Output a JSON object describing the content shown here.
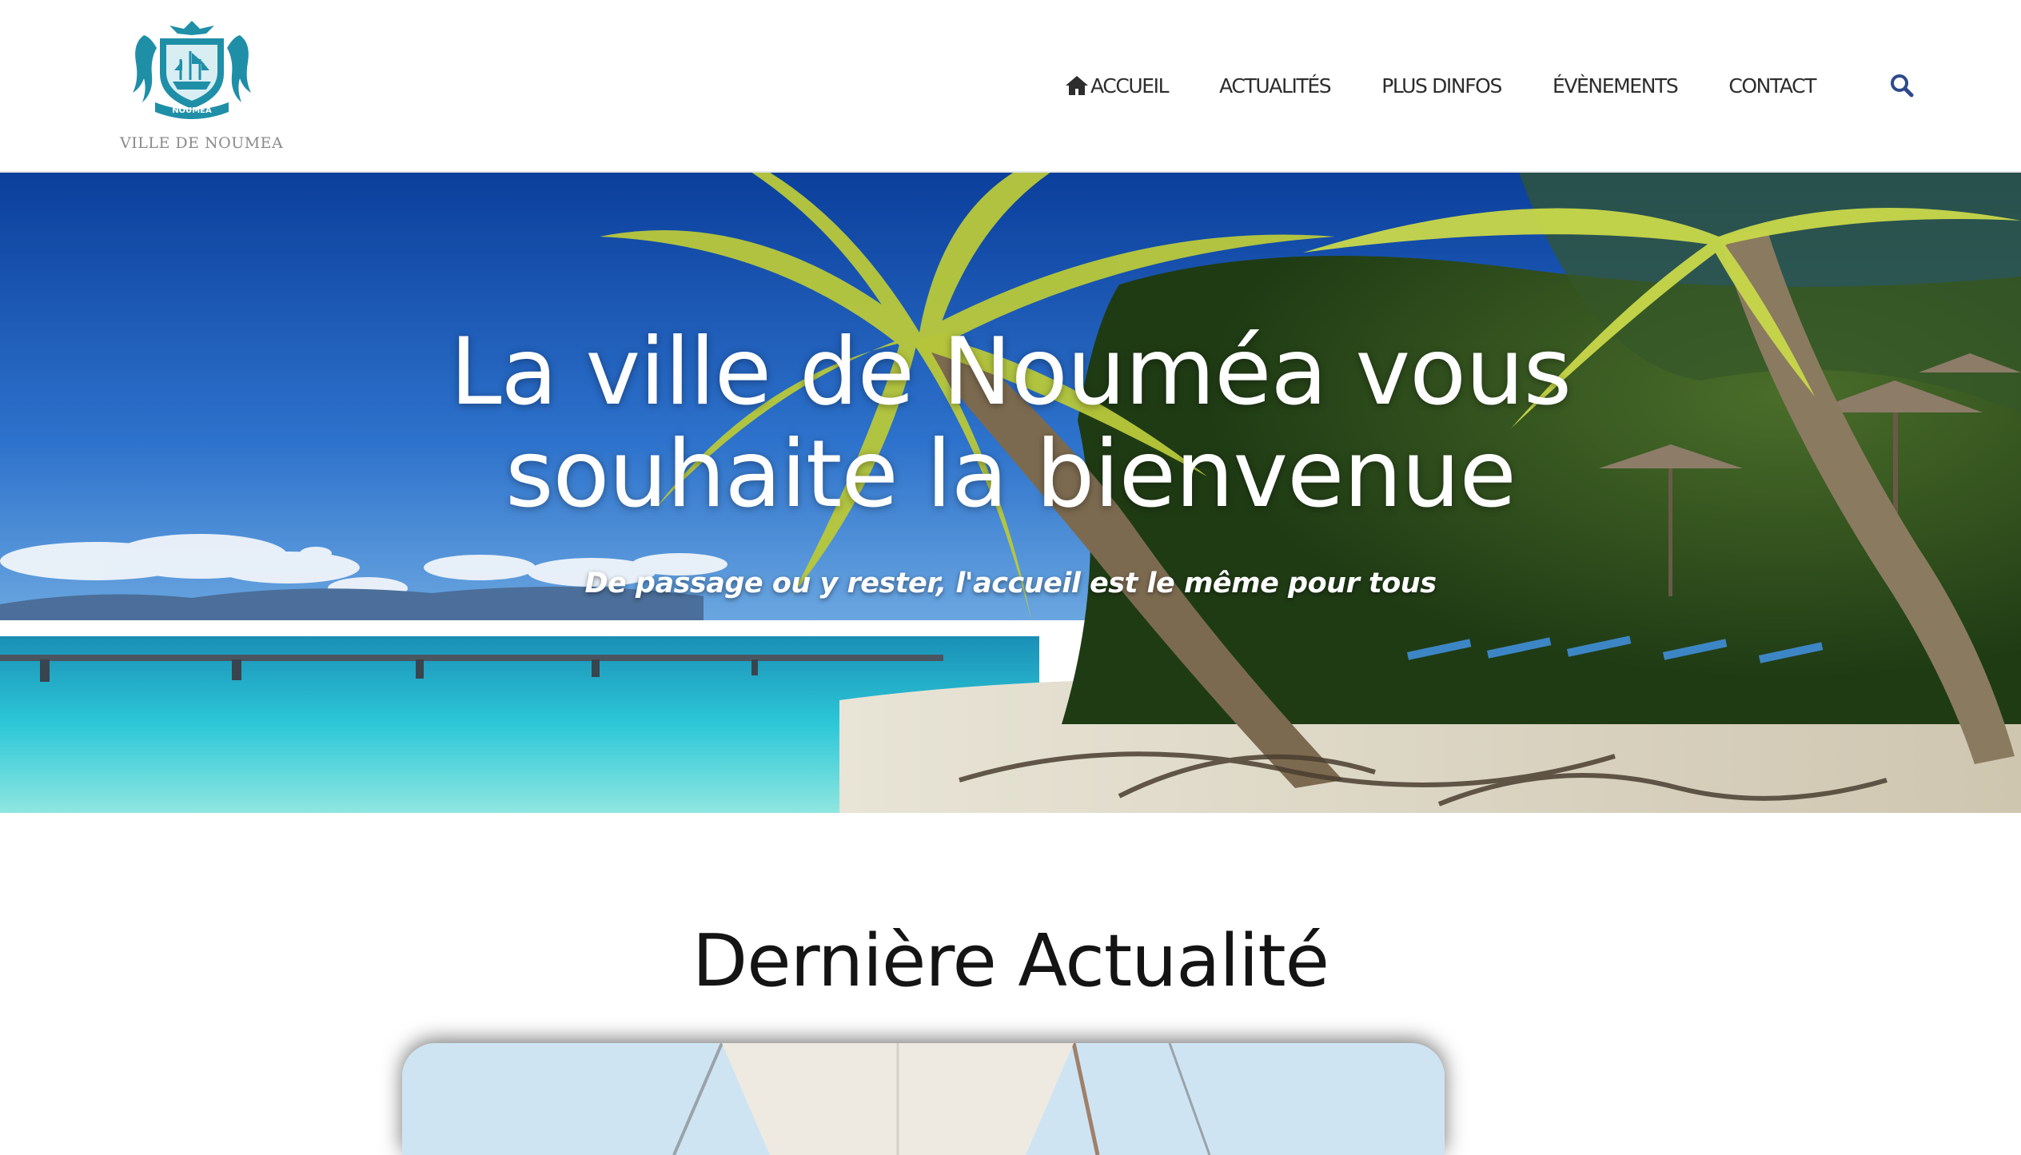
{
  "header": {
    "logo_text": "VILLE DE NOUMEA",
    "logo_crest_text": "NOUMEA",
    "nav": [
      {
        "label": "ACCUEIL",
        "icon": "home-icon"
      },
      {
        "label": "ACTUALITÉS"
      },
      {
        "label": "PLUS DINFOS"
      },
      {
        "label": "ÉVÈNEMENTS"
      },
      {
        "label": "CONTACT"
      }
    ],
    "search_icon": "search-icon",
    "search_color": "#2e4a8c"
  },
  "hero": {
    "title_line1": "La ville de Nouméa vous",
    "title_line2": "souhaite la bienvenue",
    "subtitle": "De passage ou y rester, l'accueil est le même pour tous"
  },
  "news": {
    "section_title": "Dernière Actualité"
  },
  "colors": {
    "logo_teal": "#1f8fa8",
    "nav_text": "#2d2d2d",
    "search_blue": "#2e4a8c"
  }
}
